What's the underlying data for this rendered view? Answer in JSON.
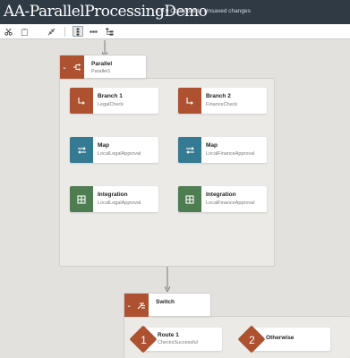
{
  "header": {
    "title": "AA-ParallelProcessingDemo",
    "status": "1.0.0 Configured - Unsaved changes"
  },
  "toolbar": {
    "icons": [
      "scissors-icon",
      "paste-icon",
      "collapse-icon",
      "vertical-layout-icon",
      "horizontal-layout-icon",
      "tree-layout-icon"
    ],
    "active": "vertical-layout-icon"
  },
  "parallel": {
    "title": "Parallel",
    "subtitle": "Parallel1",
    "branches": [
      {
        "title": "Branch 1",
        "subtitle": "LegalCheck",
        "steps": [
          {
            "type": "Map",
            "subtitle": "LocalLegalApproval",
            "color": "#357a93"
          },
          {
            "type": "Integration",
            "subtitle": "LocalLegalApproval",
            "color": "#4f7d52"
          }
        ]
      },
      {
        "title": "Branch 2",
        "subtitle": "FinanceCheck",
        "steps": [
          {
            "type": "Map",
            "subtitle": "LocalFinanceApproval",
            "color": "#357a93"
          },
          {
            "type": "Integration",
            "subtitle": "LocalFinanceApproval",
            "color": "#4f7d52"
          }
        ]
      }
    ]
  },
  "switch": {
    "title": "Switch",
    "routes": [
      {
        "number": "1",
        "title": "Route 1",
        "subtitle": "ChecksSuccessful"
      },
      {
        "number": "2",
        "title": "Otherwise",
        "subtitle": ""
      }
    ]
  },
  "colors": {
    "header": "#2f3a45",
    "accent_brown": "#ad5131",
    "map_blue": "#357a93",
    "integration_green": "#4f7d52",
    "canvas": "#e3e1de"
  }
}
